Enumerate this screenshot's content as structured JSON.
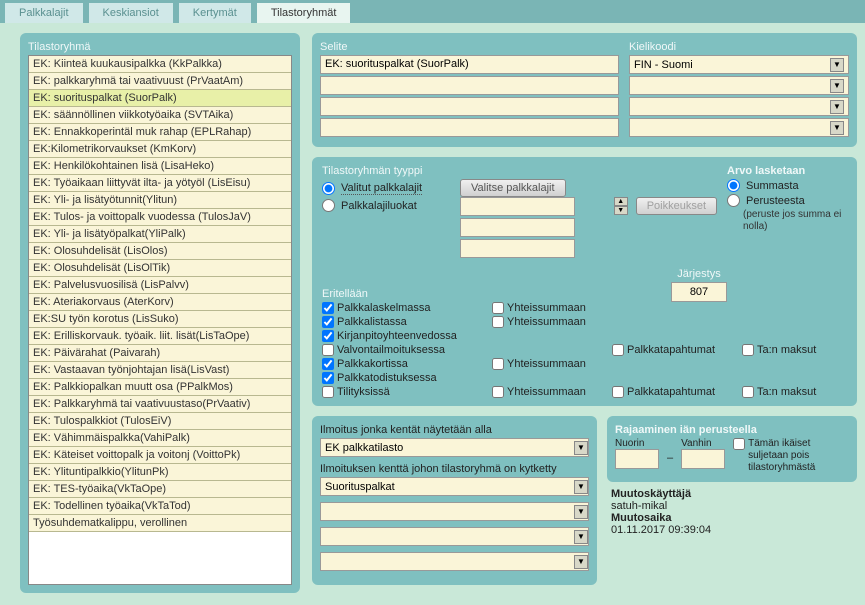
{
  "tabs": {
    "t0": "Palkkalajit",
    "t1": "Keskiansiot",
    "t2": "Kertymät",
    "t3": "Tilastoryhmät"
  },
  "left": {
    "title": "Tilastoryhmä",
    "items": [
      "EK: Kiinteä kuukausipalkka (KkPalkka)",
      "EK: palkkaryhmä tai vaativuust  (PrVaatAm)",
      "EK: suorituspalkat (SuorPalk)",
      "EK: säännöllinen viikkotyöaika (SVTAika)",
      "EK: Ennakkoperintäl muk rahap (EPLRahap)",
      "EK:Kilometrikorvaukset (KmKorv)",
      "EK: Henkilökohtainen lisä (LisaHeko)",
      "EK: Työaikaan liittyvät ilta- ja yötyöl (LisEisu)",
      "EK: Yli- ja lisätyötunnit(Ylitun)",
      "EK: Tulos- ja voittopalk vuodessa (TulosJaV)",
      "EK: Yli- ja lisätyöpalkat(YliPalk)",
      "EK: Olosuhdelisät (LisOlos)",
      "EK: Olosuhdelisät (LisOlTik)",
      "EK: Palvelusvuosilisä (LisPalvv)",
      "EK: Ateriakorvaus (AterKorv)",
      "EK:SU työn korotus (LisSuko)",
      "EK: Erilliskorvauk. työaik. liit. lisät(LisTaOpe)",
      "EK: Päivärahat (Paivarah)",
      "EK: Vastaavan työnjohtajan lisä(LisVast)",
      "EK: Palkkiopalkan muutt osa (PPalkMos)",
      "EK: Palkkaryhmä tai vaativuustaso(PrVaativ)",
      "EK: Tulospalkkiot (TulosEiV)",
      "EK: Vähimmäispalkka(VahiPalk)",
      "EK: Käteiset voittopalk ja voitonj (VoittoPk)",
      "EK: Ylituntipalkkio(YlitunPk)",
      "EK: TES-työaika(VkTaOpe)",
      "EK: Todellinen työaika(VkTaTod)",
      "Työsuhdematkalippu, verollinen"
    ]
  },
  "top": {
    "seliteLabel": "Selite",
    "seliteValue": "EK: suorituspalkat (SuorPalk)",
    "kieliLabel": "Kielikoodi",
    "kieliValue": "FIN - Suomi"
  },
  "mid": {
    "typeLabel": "Tilastoryhmän tyyppi",
    "valitut": "Valitut palkkalajit",
    "luokat": "Palkkalajiluokat",
    "valitseBtn": "Valitse palkkalajit",
    "poikBtn": "Poikkeukset",
    "arvoLabel": "Arvo lasketaan",
    "summasta": "Summasta",
    "perusteesta": "Perusteesta",
    "perusteNote": "(peruste jos summa ei nolla)",
    "eritelLabel": "Eritellään",
    "jarjLabel": "Järjestys",
    "jarjVal": "807",
    "chk": {
      "palkkalask": "Palkkalaskelmassa",
      "palkkalista": "Palkkalistassa",
      "kirjanpito": "Kirjanpitoyhteenvedossa",
      "valvonta": "Valvontailmoituksessa",
      "palkkakort": "Palkkakortissa",
      "palkkatod": "Palkkatodistuksessa",
      "tilityks": "Tilityksissä",
      "yhteis": "Yhteissummaan",
      "palkkatap": "Palkkatapahtumat",
      "tan": "Ta:n maksut"
    }
  },
  "ilmo": {
    "l1": "Ilmoitus jonka kentät näytetään alla",
    "v1": "EK palkkatilasto",
    "l2": "Ilmoituksen kenttä johon tilastoryhmä on kytketty",
    "v2": "Suorituspalkat"
  },
  "raja": {
    "title": "Rajaaminen iän perusteella",
    "nuorin": "Nuorin",
    "vanhin": "Vanhin",
    "dash": "–",
    "sulj": "Tämän ikäiset suljetaan pois tilastoryhmästä"
  },
  "muutos": {
    "l1": "Muutoskäyttäjä",
    "v1": "satuh-mikal",
    "l2": "Muutosaika",
    "v2": "01.11.2017 09:39:04"
  }
}
